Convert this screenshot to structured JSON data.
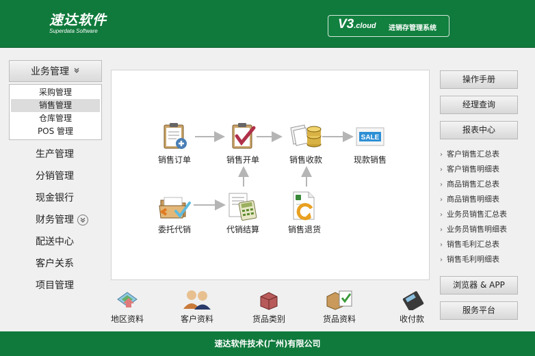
{
  "header": {
    "logo_main": "速达软件",
    "logo_sub": "Superdata Software",
    "version": "V3",
    "version_sub": ".cloud",
    "system_name": "进销存管理系统"
  },
  "nav": {
    "group_label": "业务管理",
    "submenu": [
      {
        "label": "采购管理"
      },
      {
        "label": "销售管理"
      },
      {
        "label": "仓库管理"
      },
      {
        "label": "POS 管理"
      }
    ],
    "items": [
      {
        "label": "生产管理"
      },
      {
        "label": "分销管理"
      },
      {
        "label": "现金银行"
      },
      {
        "label": "财务管理"
      },
      {
        "label": "配送中心"
      },
      {
        "label": "客户关系"
      },
      {
        "label": "项目管理"
      }
    ]
  },
  "flow": {
    "items": [
      {
        "label": "销售订单",
        "icon": "clipboard-plus-icon"
      },
      {
        "label": "销售开单",
        "icon": "clipboard-check-icon"
      },
      {
        "label": "销售收款",
        "icon": "coins-icon"
      },
      {
        "label": "现款销售",
        "icon": "sale-tag-icon"
      },
      {
        "label": "委托代销",
        "icon": "folder-check-icon"
      },
      {
        "label": "代销结算",
        "icon": "calculator-icon"
      },
      {
        "label": "销售退货",
        "icon": "return-document-icon"
      }
    ],
    "sale_text": "SALE"
  },
  "toolbar": [
    {
      "label": "地区资料",
      "icon": "region-icon"
    },
    {
      "label": "客户资料",
      "icon": "customer-icon"
    },
    {
      "label": "货品类别",
      "icon": "goods-category-icon"
    },
    {
      "label": "货品资料",
      "icon": "goods-info-icon"
    },
    {
      "label": "收付款",
      "icon": "payment-icon"
    }
  ],
  "right": {
    "manual": "操作手册",
    "manager_query": "经理查询",
    "report_center": "报表中心",
    "reports": [
      "客户销售汇总表",
      "客户销售明细表",
      "商品销售汇总表",
      "商品销售明细表",
      "业务员销售汇总表",
      "业务员销售明细表",
      "销售毛利汇总表",
      "销售毛利明细表"
    ],
    "browser_app": "浏览器 & APP",
    "service_platform": "服务平台"
  },
  "footer": {
    "company": "速达软件技术(广州)有限公司"
  },
  "colors": {
    "brand_green": "#107a3c"
  }
}
